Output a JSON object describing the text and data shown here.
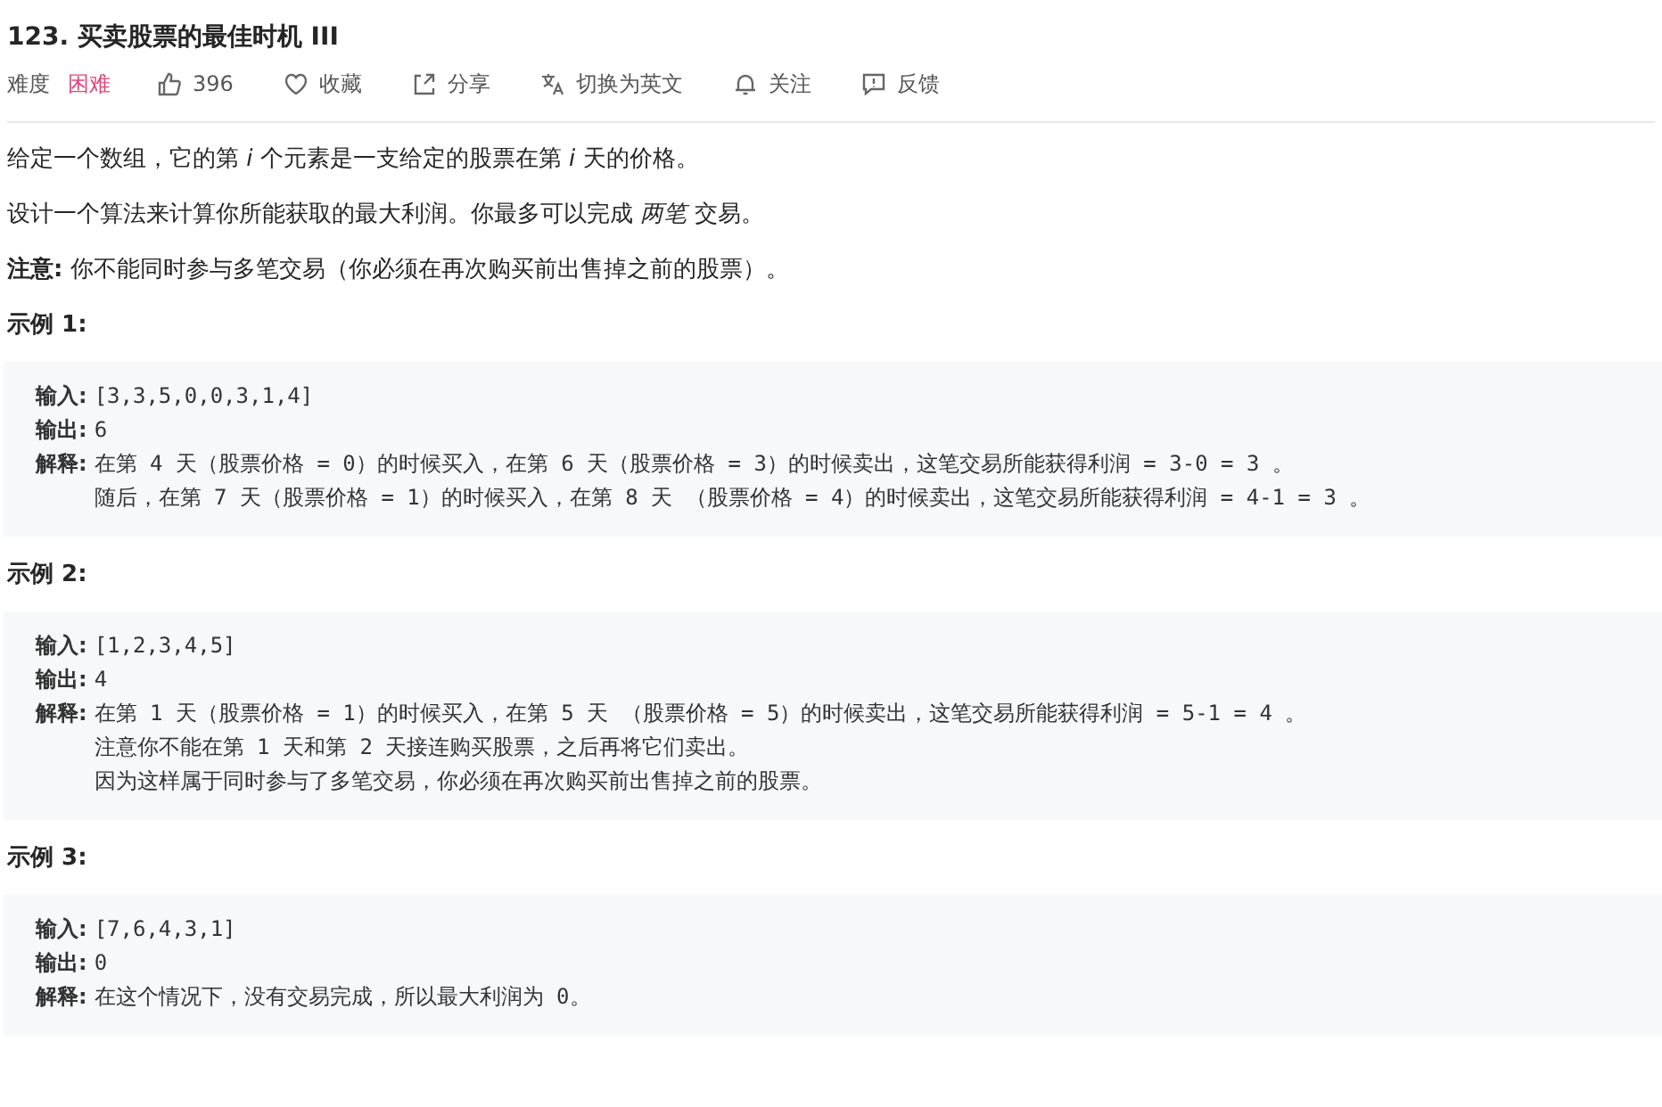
{
  "title": "123. 买卖股票的最佳时机 III",
  "meta": {
    "difficulty_label": "难度",
    "difficulty": "困难",
    "actions": [
      {
        "kind": "like",
        "label": "396"
      },
      {
        "kind": "favorite",
        "label": "收藏"
      },
      {
        "kind": "share",
        "label": "分享"
      },
      {
        "kind": "translate",
        "label": "切换为英文"
      },
      {
        "kind": "follow",
        "label": "关注"
      },
      {
        "kind": "feedback",
        "label": "反馈"
      }
    ]
  },
  "description": [
    "给定一个数组，它的第 *i* 个元素是一支给定的股票在第 *i* 天的价格。",
    "设计一个算法来计算你所能获取的最大利润。你最多可以完成 *两笔* 交易。",
    "**注意:** 你不能同时参与多笔交易（你必须在再次购买前出售掉之前的股票）。"
  ],
  "examples": [
    {
      "heading": "示例 1:",
      "input_label": "输入:",
      "input": "[3,3,5,0,0,3,1,4]",
      "output_label": "输出:",
      "output": "6",
      "explanation_label": "解释:",
      "explanation": [
        "在第 4 天（股票价格 = 0）的时候买入，在第 6 天（股票价格 = 3）的时候卖出，这笔交易所能获得利润 = 3-0 = 3 。",
        "随后，在第 7 天（股票价格 = 1）的时候买入，在第 8 天 （股票价格 = 4）的时候卖出，这笔交易所能获得利润 = 4-1 = 3 。"
      ]
    },
    {
      "heading": "示例 2:",
      "input_label": "输入:",
      "input": "[1,2,3,4,5]",
      "output_label": "输出:",
      "output": "4",
      "explanation_label": "解释:",
      "explanation": [
        "在第 1 天（股票价格 = 1）的时候买入，在第 5 天 （股票价格 = 5）的时候卖出，这笔交易所能获得利润 = 5-1 = 4 。",
        "注意你不能在第 1 天和第 2 天接连购买股票，之后再将它们卖出。",
        "因为这样属于同时参与了多笔交易，你必须在再次购买前出售掉之前的股票。"
      ]
    },
    {
      "heading": "示例 3:",
      "input_label": "输入:",
      "input": "[7,6,4,3,1]",
      "output_label": "输出:",
      "output": "0",
      "explanation_label": "解释:",
      "explanation": [
        "在这个情况下，没有交易完成，所以最大利润为 0。"
      ]
    }
  ]
}
